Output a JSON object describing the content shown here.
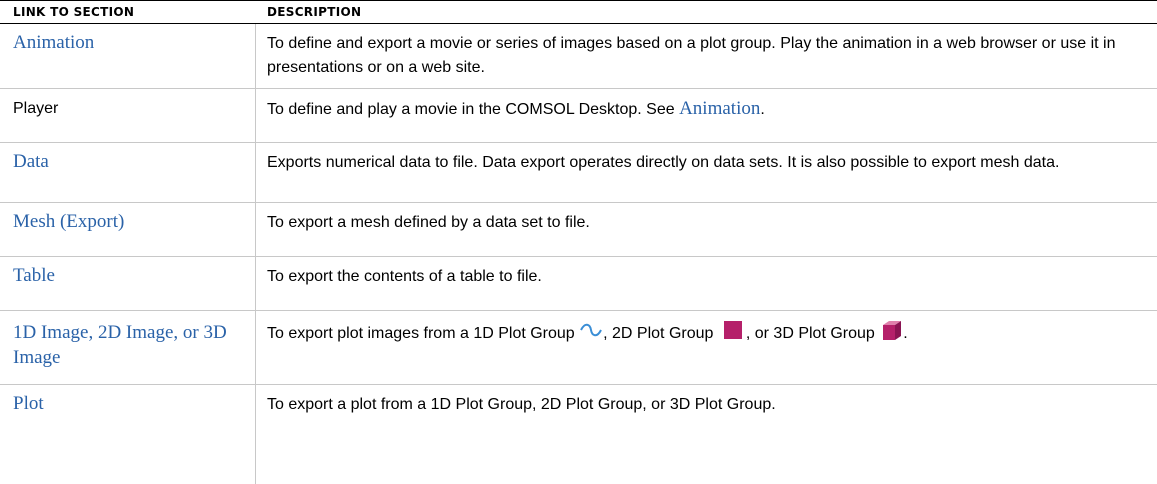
{
  "header": {
    "col1": "LINK TO SECTION",
    "col2": "DESCRIPTION"
  },
  "rows": [
    {
      "link": "Animation",
      "desc": "To define and export a movie or series of images based on a plot group. Play the animation in a web browser or use it in presentations or on a web site."
    },
    {
      "label": "Player",
      "desc_before": "To define and play a movie in the COMSOL Desktop. See ",
      "desc_link": "Animation",
      "desc_after": "."
    },
    {
      "link": "Data",
      "desc": "Exports numerical data to file. Data export operates directly on data sets. It is also possible to export mesh data."
    },
    {
      "link": "Mesh (Export)",
      "desc": "To export a mesh defined by a data set to file."
    },
    {
      "link": "Table",
      "desc": "To export the contents of a table to file."
    },
    {
      "link": "1D Image, 2D Image, or 3D Image",
      "desc_p1": "To export plot images from a 1D Plot Group ",
      "desc_p2": ", 2D Plot Group ",
      "desc_p3": ", or 3D Plot Group ",
      "desc_p4": "."
    },
    {
      "link": "Plot",
      "desc": "To export a plot from a 1D Plot Group, 2D Plot Group, or 3D Plot Group."
    }
  ],
  "colors": {
    "link": "#2a62a8",
    "icon": "#b5206a"
  }
}
